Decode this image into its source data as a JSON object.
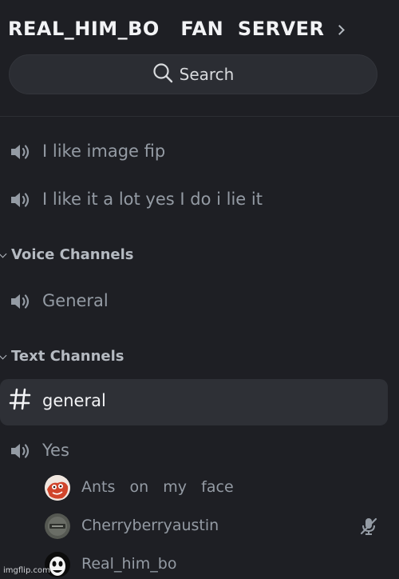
{
  "server": {
    "title": "REAL_HIM_BO   FAN  SERVER"
  },
  "search": {
    "label": "Search"
  },
  "channels_top": [
    {
      "label": "I like image fip",
      "icon": "speaker-icon"
    },
    {
      "label": "I like it a lot yes I do i lie it",
      "icon": "speaker-icon"
    }
  ],
  "voice_category": {
    "label": "Voice Channels",
    "channels": [
      {
        "label": "General",
        "icon": "speaker-icon"
      }
    ]
  },
  "text_category": {
    "label": "Text Channels",
    "channels": [
      {
        "label": "general",
        "icon": "hash-icon",
        "selected": true
      },
      {
        "label": "Yes",
        "icon": "speaker-icon"
      }
    ]
  },
  "voice_members": [
    {
      "name": "Ants   on   my   face",
      "muted": false
    },
    {
      "name": "Cherryberryaustin",
      "muted": true
    },
    {
      "name": "Real_him_bo",
      "muted": false
    }
  ],
  "watermark": "imgflip.com",
  "colors": {
    "background": "#1e1f24",
    "search_bg": "#2b2d33",
    "selected_bg": "#2e3036",
    "title": "#f2f3f5",
    "muted_text": "#949ba4"
  }
}
